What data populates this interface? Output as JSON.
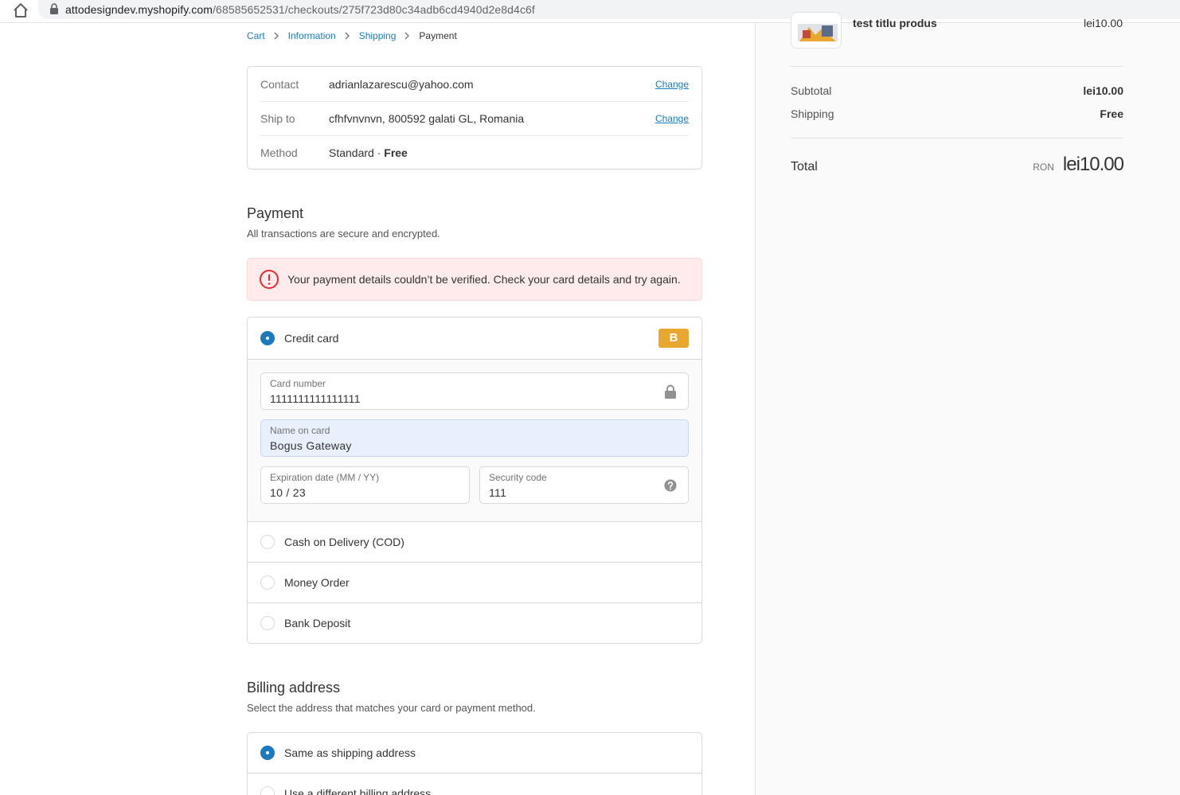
{
  "browser": {
    "url_host": "attodesigndev.myshopify.com",
    "url_path": "/68585652531/checkouts/275f723d80c34adb6cd4940d2e8d4c6f"
  },
  "breadcrumb": {
    "cart": "Cart",
    "information": "Information",
    "shipping": "Shipping",
    "payment": "Payment"
  },
  "review": {
    "contact_label": "Contact",
    "contact_value": "adrianlazarescu@yahoo.com",
    "ship_label": "Ship to",
    "ship_value": "cfhfvnvnvn, 800592 galati GL, Romania",
    "method_label": "Method",
    "method_value": "Standard · ",
    "method_price": "Free",
    "change_label": "Change"
  },
  "payment": {
    "title": "Payment",
    "subtitle": "All transactions are secure and encrypted.",
    "error": "Your payment details couldn’t be verified. Check your card details and try again.",
    "credit_card_label": "Credit card",
    "brand_badge": "B",
    "card_number_label": "Card number",
    "card_number_value": "1111111111111111",
    "name_label": "Name on card",
    "name_value": "Bogus Gateway",
    "expiry_label": "Expiration date (MM / YY)",
    "expiry_value": "10 / 23",
    "cvv_label": "Security code",
    "cvv_value": "111",
    "cod_label": "Cash on Delivery (COD)",
    "money_order_label": "Money Order",
    "bank_deposit_label": "Bank Deposit"
  },
  "billing": {
    "title": "Billing address",
    "subtitle": "Select the address that matches your card or payment method.",
    "same_label": "Same as shipping address",
    "different_label": "Use a different billing address"
  },
  "summary": {
    "product_name": "test titlu produs",
    "product_price": "lei10.00",
    "subtotal_label": "Subtotal",
    "subtotal_value": "lei10.00",
    "shipping_label": "Shipping",
    "shipping_value": "Free",
    "total_label": "Total",
    "total_currency": "RON",
    "total_value": "lei10.00"
  },
  "colors": {
    "accent": "#197bbd",
    "error_bg": "#ffebeb",
    "error_icon": "#e32c2b",
    "badge": "#e8a72f"
  }
}
